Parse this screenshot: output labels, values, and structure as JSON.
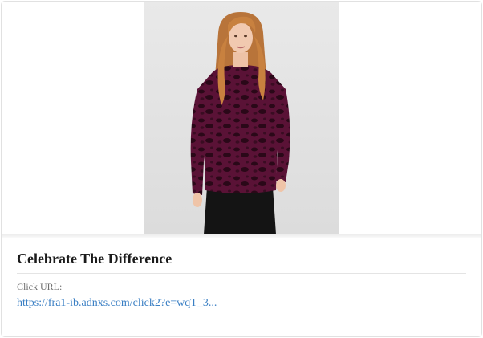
{
  "ad": {
    "image_alt": "Woman wearing a burgundy velvet leopard-print long-sleeve top with black pants",
    "title": "Celebrate The Difference",
    "click_label": "Click URL:",
    "click_url": "https://fra1-ib.adnxs.com/click2?e=wqT_3..."
  },
  "colors": {
    "top": "#5a1236",
    "top_pattern": "#2a0818",
    "pants": "#141414",
    "hair": "#c8813f",
    "skin": "#f0c7ad",
    "link": "#3a7fc4",
    "title": "#1b1b1b",
    "background": "#e6e6e6"
  }
}
